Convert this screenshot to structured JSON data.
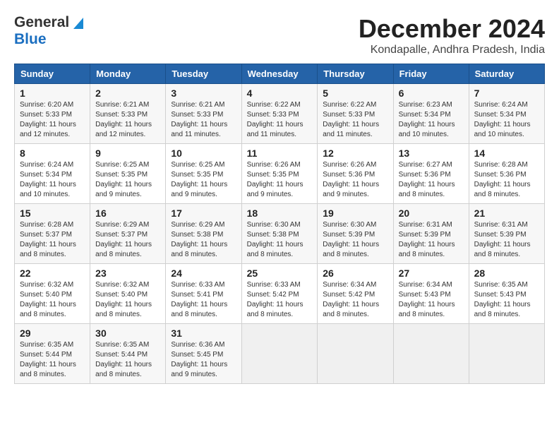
{
  "header": {
    "logo_general": "General",
    "logo_blue": "Blue",
    "month_title": "December 2024",
    "location": "Kondapalle, Andhra Pradesh, India"
  },
  "weekdays": [
    "Sunday",
    "Monday",
    "Tuesday",
    "Wednesday",
    "Thursday",
    "Friday",
    "Saturday"
  ],
  "weeks": [
    [
      {
        "day": "1",
        "info": "Sunrise: 6:20 AM\nSunset: 5:33 PM\nDaylight: 11 hours\nand 12 minutes."
      },
      {
        "day": "2",
        "info": "Sunrise: 6:21 AM\nSunset: 5:33 PM\nDaylight: 11 hours\nand 12 minutes."
      },
      {
        "day": "3",
        "info": "Sunrise: 6:21 AM\nSunset: 5:33 PM\nDaylight: 11 hours\nand 11 minutes."
      },
      {
        "day": "4",
        "info": "Sunrise: 6:22 AM\nSunset: 5:33 PM\nDaylight: 11 hours\nand 11 minutes."
      },
      {
        "day": "5",
        "info": "Sunrise: 6:22 AM\nSunset: 5:33 PM\nDaylight: 11 hours\nand 11 minutes."
      },
      {
        "day": "6",
        "info": "Sunrise: 6:23 AM\nSunset: 5:34 PM\nDaylight: 11 hours\nand 10 minutes."
      },
      {
        "day": "7",
        "info": "Sunrise: 6:24 AM\nSunset: 5:34 PM\nDaylight: 11 hours\nand 10 minutes."
      }
    ],
    [
      {
        "day": "8",
        "info": "Sunrise: 6:24 AM\nSunset: 5:34 PM\nDaylight: 11 hours\nand 10 minutes."
      },
      {
        "day": "9",
        "info": "Sunrise: 6:25 AM\nSunset: 5:35 PM\nDaylight: 11 hours\nand 9 minutes."
      },
      {
        "day": "10",
        "info": "Sunrise: 6:25 AM\nSunset: 5:35 PM\nDaylight: 11 hours\nand 9 minutes."
      },
      {
        "day": "11",
        "info": "Sunrise: 6:26 AM\nSunset: 5:35 PM\nDaylight: 11 hours\nand 9 minutes."
      },
      {
        "day": "12",
        "info": "Sunrise: 6:26 AM\nSunset: 5:36 PM\nDaylight: 11 hours\nand 9 minutes."
      },
      {
        "day": "13",
        "info": "Sunrise: 6:27 AM\nSunset: 5:36 PM\nDaylight: 11 hours\nand 8 minutes."
      },
      {
        "day": "14",
        "info": "Sunrise: 6:28 AM\nSunset: 5:36 PM\nDaylight: 11 hours\nand 8 minutes."
      }
    ],
    [
      {
        "day": "15",
        "info": "Sunrise: 6:28 AM\nSunset: 5:37 PM\nDaylight: 11 hours\nand 8 minutes."
      },
      {
        "day": "16",
        "info": "Sunrise: 6:29 AM\nSunset: 5:37 PM\nDaylight: 11 hours\nand 8 minutes."
      },
      {
        "day": "17",
        "info": "Sunrise: 6:29 AM\nSunset: 5:38 PM\nDaylight: 11 hours\nand 8 minutes."
      },
      {
        "day": "18",
        "info": "Sunrise: 6:30 AM\nSunset: 5:38 PM\nDaylight: 11 hours\nand 8 minutes."
      },
      {
        "day": "19",
        "info": "Sunrise: 6:30 AM\nSunset: 5:39 PM\nDaylight: 11 hours\nand 8 minutes."
      },
      {
        "day": "20",
        "info": "Sunrise: 6:31 AM\nSunset: 5:39 PM\nDaylight: 11 hours\nand 8 minutes."
      },
      {
        "day": "21",
        "info": "Sunrise: 6:31 AM\nSunset: 5:39 PM\nDaylight: 11 hours\nand 8 minutes."
      }
    ],
    [
      {
        "day": "22",
        "info": "Sunrise: 6:32 AM\nSunset: 5:40 PM\nDaylight: 11 hours\nand 8 minutes."
      },
      {
        "day": "23",
        "info": "Sunrise: 6:32 AM\nSunset: 5:40 PM\nDaylight: 11 hours\nand 8 minutes."
      },
      {
        "day": "24",
        "info": "Sunrise: 6:33 AM\nSunset: 5:41 PM\nDaylight: 11 hours\nand 8 minutes."
      },
      {
        "day": "25",
        "info": "Sunrise: 6:33 AM\nSunset: 5:42 PM\nDaylight: 11 hours\nand 8 minutes."
      },
      {
        "day": "26",
        "info": "Sunrise: 6:34 AM\nSunset: 5:42 PM\nDaylight: 11 hours\nand 8 minutes."
      },
      {
        "day": "27",
        "info": "Sunrise: 6:34 AM\nSunset: 5:43 PM\nDaylight: 11 hours\nand 8 minutes."
      },
      {
        "day": "28",
        "info": "Sunrise: 6:35 AM\nSunset: 5:43 PM\nDaylight: 11 hours\nand 8 minutes."
      }
    ],
    [
      {
        "day": "29",
        "info": "Sunrise: 6:35 AM\nSunset: 5:44 PM\nDaylight: 11 hours\nand 8 minutes."
      },
      {
        "day": "30",
        "info": "Sunrise: 6:35 AM\nSunset: 5:44 PM\nDaylight: 11 hours\nand 8 minutes."
      },
      {
        "day": "31",
        "info": "Sunrise: 6:36 AM\nSunset: 5:45 PM\nDaylight: 11 hours\nand 9 minutes."
      },
      {
        "day": "",
        "info": ""
      },
      {
        "day": "",
        "info": ""
      },
      {
        "day": "",
        "info": ""
      },
      {
        "day": "",
        "info": ""
      }
    ]
  ]
}
